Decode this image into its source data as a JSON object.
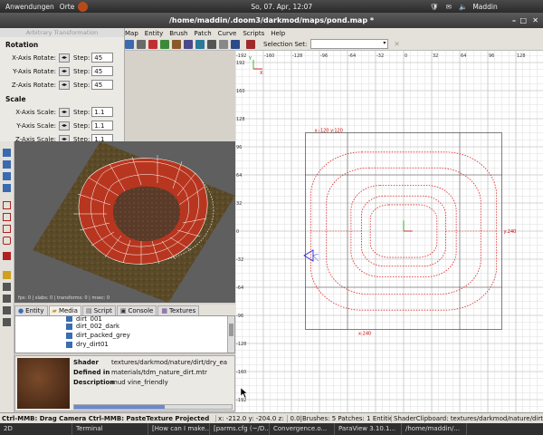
{
  "topbar": {
    "applications": "Anwendungen",
    "places": "Orte",
    "datetime": "So, 07. Apr, 12:07",
    "user": "Maddin"
  },
  "window": {
    "title": "/home/maddin/.doom3/darkmod/maps/pond.map *"
  },
  "menu": [
    "Map",
    "Entity",
    "Brush",
    "Patch",
    "Curve",
    "Scripts",
    "Help"
  ],
  "toolbar": {
    "selection_set_label": "Selection Set:"
  },
  "transform_panel": {
    "title": "Arbitrary Transformation",
    "rotation_header": "Rotation",
    "scale_header": "Scale",
    "step_label": "Step:",
    "rotate": [
      {
        "label": "X-Axis Rotate:",
        "step": "45"
      },
      {
        "label": "Y-Axis Rotate:",
        "step": "45"
      },
      {
        "label": "Z-Axis Rotate:",
        "step": "45"
      }
    ],
    "scale": [
      {
        "label": "X-Axis Scale:",
        "step": "1.1"
      },
      {
        "label": "Y-Axis Scale:",
        "step": "1.1"
      },
      {
        "label": "Z-Axis Scale:",
        "step": "1.1"
      }
    ]
  },
  "camera": {
    "stats": "fps: 0 | slabs: 0 | transforms: 0 | msec: 0"
  },
  "tabs": [
    "Entity",
    "Media",
    "Script",
    "Console",
    "Textures"
  ],
  "media_items": [
    "dirt_001",
    "dirt_002_dark",
    "dirt_packed_grey",
    "dry_dirt01"
  ],
  "shader": {
    "shader_label": "Shader",
    "shader_value": "textures/darkmod/nature/dirt/dry_ea",
    "defined_label": "Defined in",
    "defined_value": "materials/tdm_nature_dirt.mtr",
    "desc_label": "Description",
    "desc_value": "mud vine_friendly"
  },
  "grid": {
    "top_ticks": [
      "-192",
      "-160",
      "-128",
      "-96",
      "-64",
      "-32",
      "0",
      "32",
      "64",
      "96",
      "128"
    ],
    "left_ticks": [
      "224",
      "192",
      "160",
      "128",
      "96",
      "64",
      "32",
      "0",
      "-32",
      "-64",
      "-96",
      "-128",
      "-160",
      "-192",
      "-224"
    ],
    "coord_label": "x:-120 y:120",
    "y_label": "y:240",
    "x_label": "x:240",
    "axis_x": "X",
    "axis_y": "Y"
  },
  "statusbar": {
    "left": "Ctrl-MMB: Drag Camera  Ctrl-MMB: PasteTexture Projected",
    "coords": "x: -212.0  y: -204.0  z:",
    "counts": "0.0|Brushes: 5  Patches: 1  Entities: 1",
    "clipboard": "ShaderClipboard: textures/darkmod/nature/dirt"
  },
  "taskbar": [
    "2D",
    "Terminal",
    "[How can I make...",
    "[parms.cfg (~/D...",
    "Convergence.o...",
    "ParaView 3.10.1...",
    "/home/maddin/..."
  ]
}
